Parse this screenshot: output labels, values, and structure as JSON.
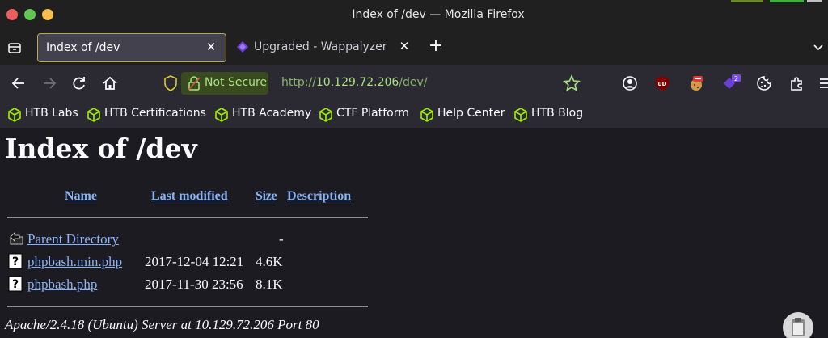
{
  "window": {
    "title": "Index of /dev — Mozilla Firefox"
  },
  "tabs": [
    {
      "label": "Index of /dev",
      "active": true
    },
    {
      "label": "Upgraded - Wappalyzer",
      "active": false
    }
  ],
  "nav": {
    "security_label": "Not Secure",
    "url_prefix": "http://",
    "url_host": "10.129.72.206",
    "url_path": "/dev/",
    "extension_badge": "2"
  },
  "bookmarks": [
    {
      "label": "HTB Labs"
    },
    {
      "label": "HTB Certifications"
    },
    {
      "label": "HTB Academy"
    },
    {
      "label": "CTF Platform"
    },
    {
      "label": "Help Center"
    },
    {
      "label": "HTB Blog"
    }
  ],
  "page": {
    "heading": "Index of /dev",
    "columns": {
      "name": "Name",
      "last_modified": "Last modified",
      "size": "Size",
      "description": "Description"
    },
    "rows": [
      {
        "name": "Parent Directory",
        "modified": "",
        "size": "-",
        "icon": "back-folder-icon"
      },
      {
        "name": "phpbash.min.php",
        "modified": "2017-12-04 12:21",
        "size": "4.6K",
        "icon": "unknown-file-icon"
      },
      {
        "name": "phpbash.php",
        "modified": "2017-11-30 23:56",
        "size": "8.1K",
        "icon": "unknown-file-icon"
      }
    ],
    "address": "Apache/2.4.18 (Ubuntu) Server at 10.129.72.206 Port 80"
  },
  "colors": {
    "link": "#8ab4f8",
    "secure_warning_text": "#a5e27d",
    "active_tab_border": "#b9a84c"
  }
}
